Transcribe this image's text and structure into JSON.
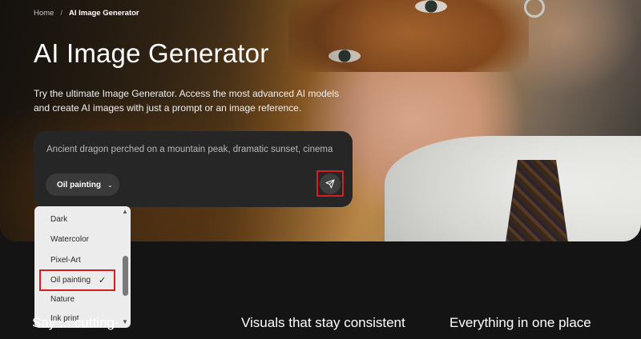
{
  "breadcrumb": {
    "home": "Home",
    "separator": "/",
    "current": "AI Image Generator"
  },
  "hero": {
    "title": "AI Image Generator",
    "subtitle": "Try the ultimate Image Generator. Access the most advanced AI models and create AI images with just a prompt or an image reference."
  },
  "prompt": {
    "value": "Ancient dragon perched on a mountain peak, dramatic sunset, cinema",
    "style_selected": "Oil painting",
    "style_chevron": "chevron-down-icon",
    "send_icon": "send-icon"
  },
  "style_menu": {
    "options": [
      "Dark",
      "Watercolor",
      "Pixel-Art",
      "Oil painting",
      "Nature",
      "Ink print"
    ],
    "selected": "Oil painting",
    "check_icon": "check-icon"
  },
  "features": [
    {
      "title": "Say ... cutting-"
    },
    {
      "title": "Visuals that stay consistent"
    },
    {
      "title": "Everything in one place"
    }
  ],
  "colors": {
    "background": "#141414",
    "prompt_box": "#262626",
    "highlight": "#d21f24",
    "menu_bg": "#ececec"
  }
}
